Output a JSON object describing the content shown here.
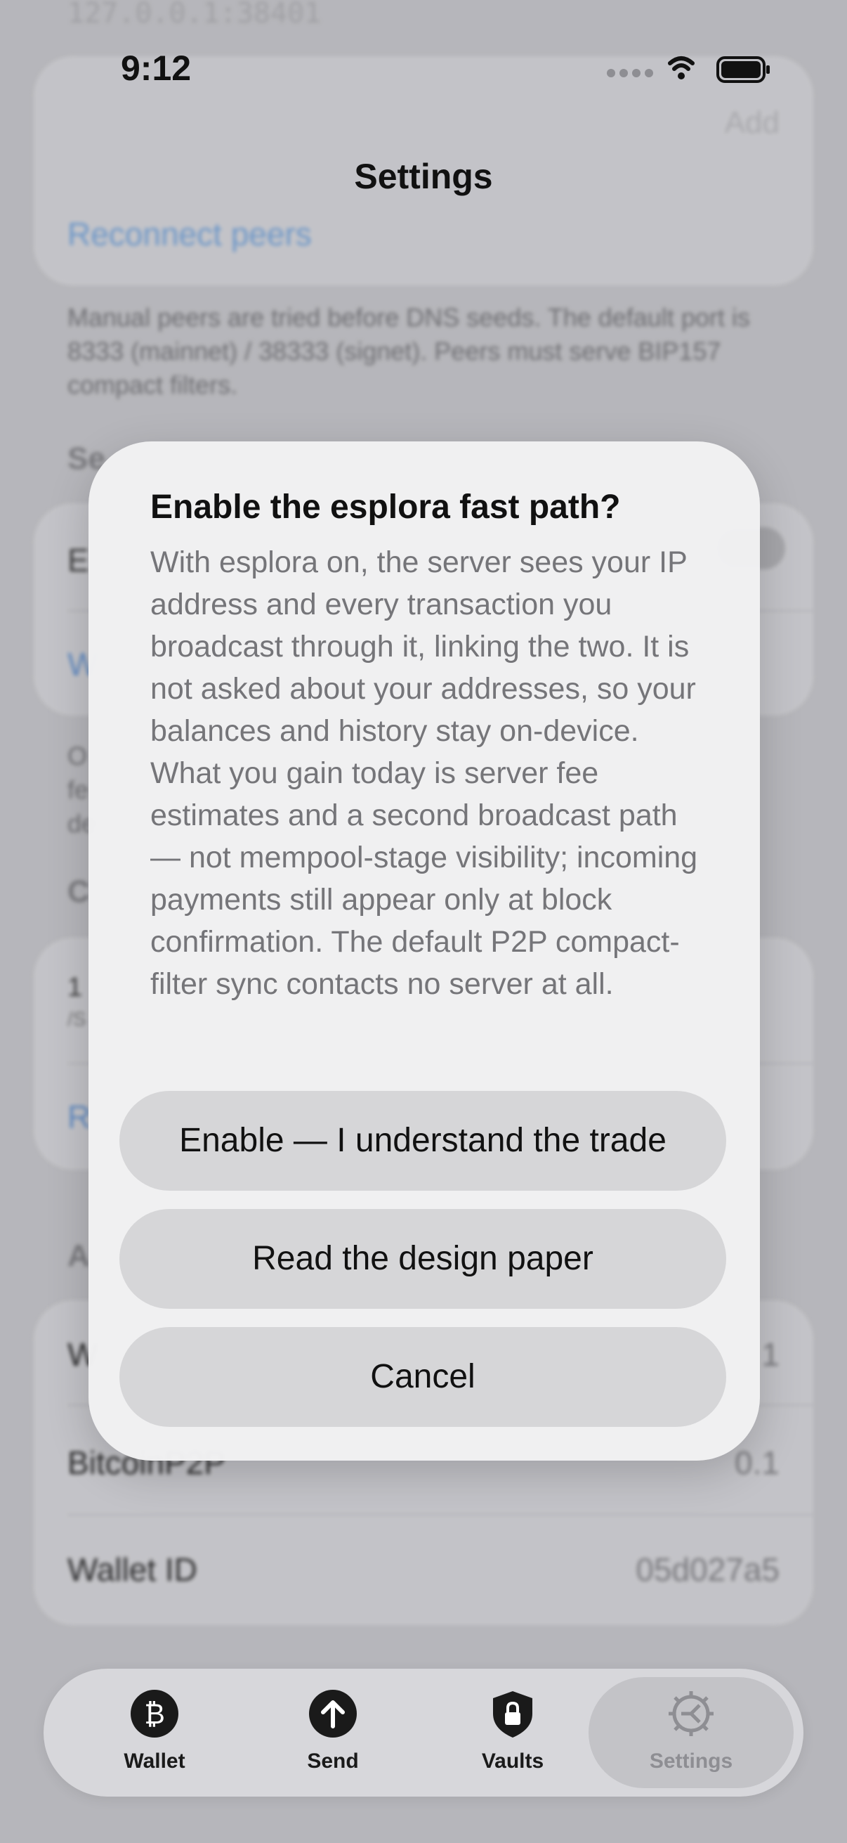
{
  "background": {
    "peer_address": "127.0.0.1:38401",
    "reconnect_label": "Reconnect peers",
    "add_label": "Add",
    "peers_footnote": "Manual peers are tried before DNS seeds. The default port is 8333 (mainnet) / 38333 (signet). Peers must serve BIP157 compact filters.",
    "about": {
      "rows": [
        {
          "label": "BitcoinP2P",
          "value": "0.1"
        },
        {
          "label": "Wallet ID",
          "value": "05d027a5"
        }
      ]
    }
  },
  "status_bar": {
    "time": "9:12"
  },
  "nav": {
    "title": "Settings"
  },
  "dialog": {
    "title": "Enable the esplora fast path?",
    "body": "With esplora on, the server sees your IP address and every transaction you broadcast through it, linking the two. It is not asked about your addresses, so your balances and history stay on-device. What you gain today is server fee estimates and a second broadcast path — not mempool-stage visibility; incoming payments still appear only at block confirmation. The default P2P compact-filter sync contacts no server at all.",
    "buttons": {
      "enable": "Enable — I understand the trade",
      "read": "Read the design paper",
      "cancel": "Cancel"
    }
  },
  "tabbar": {
    "tabs": [
      {
        "label": "Wallet",
        "icon": "bitcoin-icon"
      },
      {
        "label": "Send",
        "icon": "arrow-up-icon"
      },
      {
        "label": "Vaults",
        "icon": "lock-shield-icon"
      },
      {
        "label": "Settings",
        "icon": "gear-icon"
      }
    ],
    "selected": "Settings"
  }
}
